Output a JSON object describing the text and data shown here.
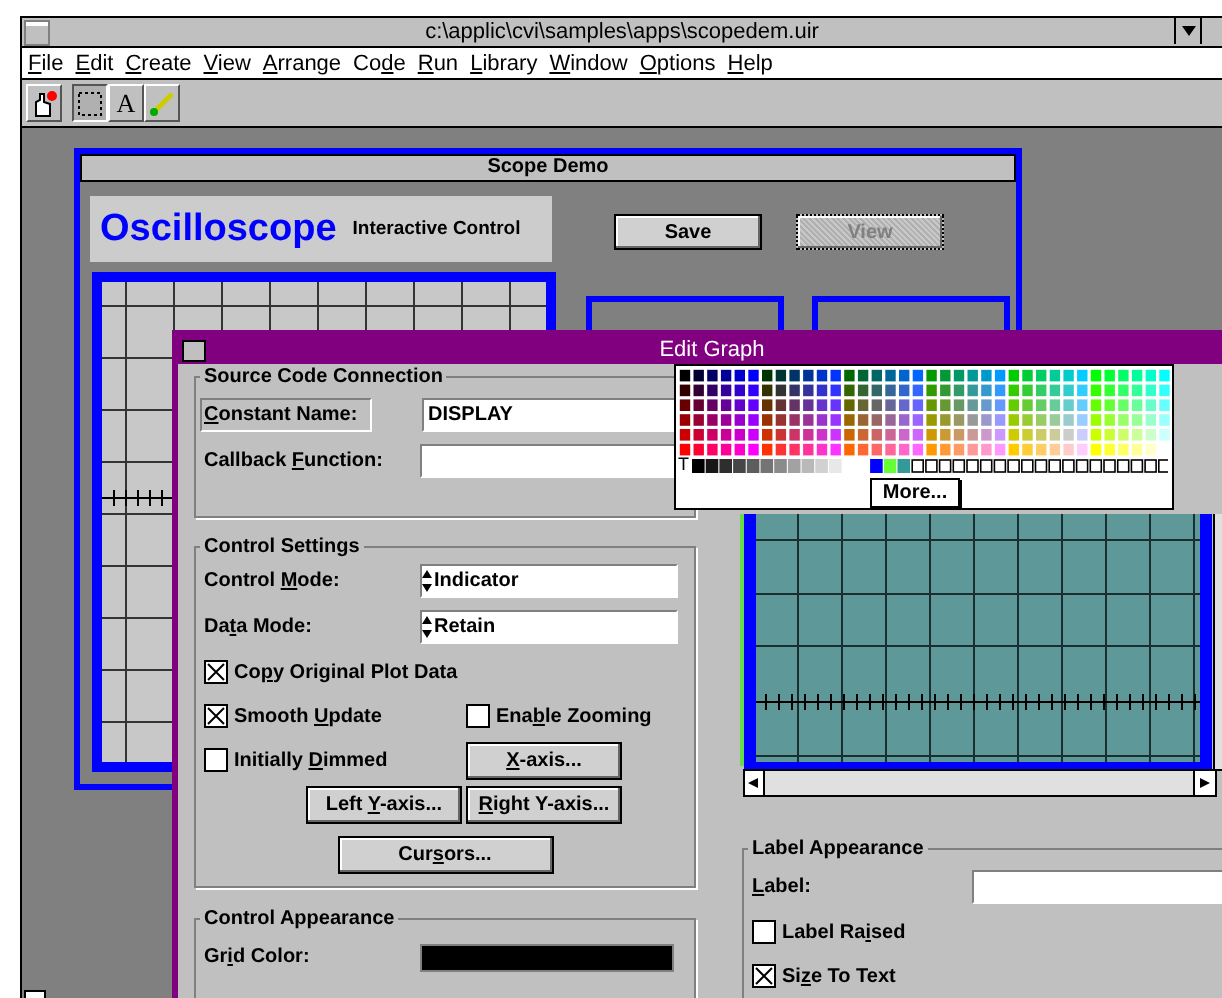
{
  "app_window": {
    "title": "c:\\applic\\cvi\\samples\\apps\\scopedem.uir",
    "menu": [
      {
        "key": "F",
        "after": "ile"
      },
      {
        "key": "E",
        "after": "dit"
      },
      {
        "key": "C",
        "after": "reate"
      },
      {
        "key": "V",
        "after": "iew"
      },
      {
        "key": "A",
        "after": "rrange"
      },
      {
        "before": "Co",
        "key": "d",
        "after": "e"
      },
      {
        "key": "R",
        "after": "un"
      },
      {
        "key": "L",
        "after": "ibrary"
      },
      {
        "key": "W",
        "after": "indow"
      },
      {
        "key": "O",
        "after": "ptions"
      },
      {
        "key": "H",
        "after": "elp"
      }
    ],
    "tools": [
      {
        "kind": "operate",
        "selected": false
      },
      {
        "kind": "select",
        "selected": true
      },
      {
        "kind": "text",
        "label": "A",
        "selected": false
      },
      {
        "kind": "color",
        "selected": false
      }
    ]
  },
  "scope_window": {
    "title": "Scope Demo",
    "heading": "Oscilloscope",
    "subheading": "Interactive Control",
    "buttons": [
      {
        "label": "Save",
        "disabled": false
      },
      {
        "label": "View",
        "disabled": true
      }
    ]
  },
  "dialog": {
    "title": "Edit Graph",
    "source": {
      "title": "Source Code Connection",
      "constant_label": {
        "key": "C",
        "after": "onstant Name:"
      },
      "constant_value": "DISPLAY",
      "callback_label": {
        "before": "Callback ",
        "key": "F",
        "after": "unction:"
      }
    },
    "settings": {
      "title": "Control Settings",
      "control_mode": {
        "label": {
          "before": "Control ",
          "key": "M",
          "after": "ode:"
        },
        "value": "Indicator"
      },
      "data_mode": {
        "label": {
          "before": "Da",
          "key": "t",
          "after": "a Mode:"
        },
        "value": "Retain"
      },
      "checks": [
        {
          "label": {
            "before": "Co",
            "key": "p",
            "after": "y Original Plot Data"
          },
          "checked": true
        },
        {
          "label": {
            "before": "Smooth ",
            "key": "U",
            "after": "pdate"
          },
          "checked": true
        },
        {
          "label": {
            "before": "Ena",
            "key": "b",
            "after": "le Zooming"
          },
          "checked": false
        },
        {
          "label": {
            "before": "Initially ",
            "key": "D",
            "after": "immed"
          },
          "checked": false
        }
      ],
      "buttons": [
        {
          "key": "X",
          "after": "-axis..."
        },
        {
          "before": "Left ",
          "key": "Y",
          "after": "-axis..."
        },
        {
          "key": "R",
          "after": "ight Y-axis..."
        },
        {
          "before": "Cur",
          "key": "s",
          "after": "ors..."
        }
      ]
    },
    "appearance": {
      "title": "Control Appearance",
      "grid_color_label": {
        "before": "Gr",
        "key": "i",
        "after": "d Color:"
      }
    },
    "label_appearance": {
      "title": "Label Appearance",
      "label": {
        "key": "L",
        "after": "abel:"
      },
      "checks": [
        {
          "label": {
            "before": "Label Ra",
            "key": "i",
            "after": "sed"
          },
          "checked": false
        },
        {
          "label": {
            "before": "Si",
            "key": "z",
            "after": "e To Text"
          },
          "checked": true
        }
      ]
    },
    "color_popup": {
      "transparent": "T",
      "more": "More..."
    }
  }
}
